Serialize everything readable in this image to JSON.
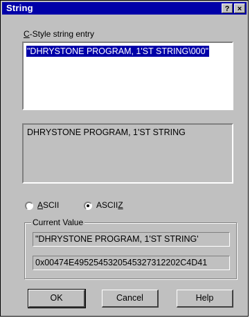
{
  "window": {
    "title": "String",
    "help_glyph": "?",
    "close_glyph": "×"
  },
  "entry": {
    "label_accel": "C",
    "label_rest": "-Style string entry",
    "value": "\"DHRYSTONE PROGRAM, 1'ST STRING\\000\""
  },
  "preview": {
    "text": "DHRYSTONE PROGRAM, 1'ST STRING"
  },
  "options": {
    "ascii": {
      "accel": "A",
      "rest": "SCII",
      "selected": false
    },
    "asciiz": {
      "pre": "ASCII",
      "accel": "Z",
      "selected": true
    }
  },
  "current_value": {
    "legend": "Current Value",
    "string": "\"DHRYSTONE PROGRAM, 1'ST STRING'",
    "hex": "0x00474E4952545320545327312202C4D41"
  },
  "buttons": {
    "ok": "OK",
    "cancel": "Cancel",
    "help": "Help"
  }
}
